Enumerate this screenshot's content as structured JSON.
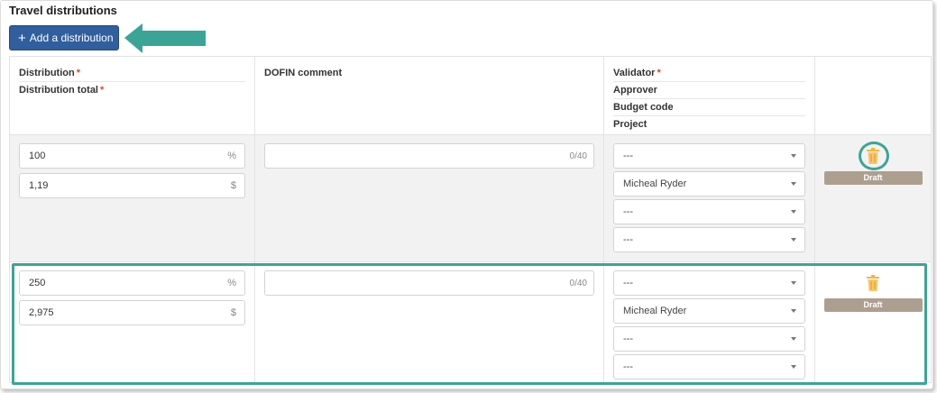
{
  "section": {
    "title": "Travel distributions"
  },
  "toolbar": {
    "add_label": "Add a distribution",
    "add_icon": "plus-icon"
  },
  "colors": {
    "primary_button": "#2f5f9e",
    "highlight": "#3aa597",
    "required": "#d9472b",
    "badge": "#ad9f8f",
    "trash": "#f5b53f"
  },
  "headers": {
    "col1": {
      "distribution": "Distribution",
      "distribution_total": "Distribution total",
      "required_mark": "*"
    },
    "col2": {
      "comment": "DOFIN comment"
    },
    "col3": {
      "validator": "Validator",
      "approver": "Approver",
      "budget_code": "Budget code",
      "project": "Project",
      "required_mark": "*"
    }
  },
  "rows": [
    {
      "distribution": "100",
      "distribution_suffix": "%",
      "total": "1,19",
      "total_suffix": "$",
      "comment_counter": "0/40",
      "validator": "---",
      "approver": "Micheal Ryder",
      "budget_code": "---",
      "project": "---",
      "status": "Draft",
      "delete_icon": "trash-icon"
    },
    {
      "distribution": "250",
      "distribution_suffix": "%",
      "total": "2,975",
      "total_suffix": "$",
      "comment_counter": "0/40",
      "validator": "---",
      "approver": "Micheal Ryder",
      "budget_code": "---",
      "project": "---",
      "status": "Draft",
      "delete_icon": "trash-icon"
    }
  ]
}
